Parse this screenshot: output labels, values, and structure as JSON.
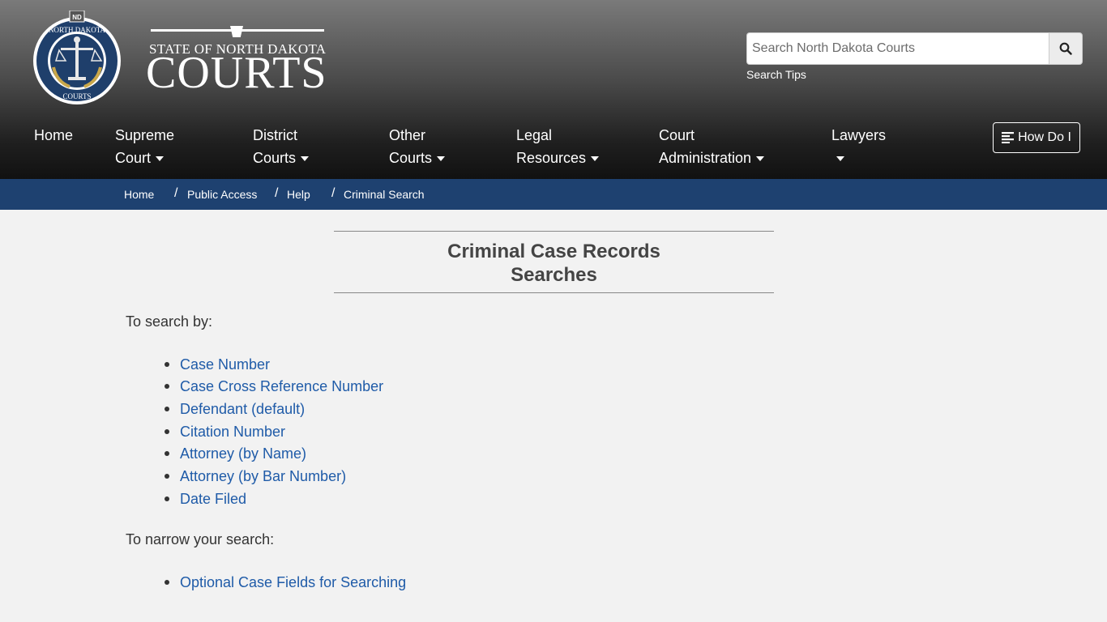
{
  "header": {
    "seal": {
      "top_text": "NORTH DAKOTA",
      "bottom_text": "COURTS",
      "badge": "ND"
    },
    "brand": {
      "line1": "STATE OF NORTH DAKOTA",
      "line2": "COURTS"
    },
    "search": {
      "placeholder": "Search North Dakota Courts",
      "value": "",
      "tips_label": "Search Tips"
    }
  },
  "nav": {
    "items": [
      {
        "line1": "Home",
        "line2": ""
      },
      {
        "line1": "Supreme",
        "line2": "Court"
      },
      {
        "line1": "District",
        "line2": "Courts"
      },
      {
        "line1": "Other",
        "line2": "Courts"
      },
      {
        "line1": "Legal",
        "line2": "Resources"
      },
      {
        "line1": "Court",
        "line2": "Administration"
      },
      {
        "line1": "Lawyers",
        "line2": ""
      }
    ],
    "how_do_i": "How Do I"
  },
  "breadcrumb": [
    "Home",
    "Public Access",
    "Help",
    "Criminal Search"
  ],
  "main": {
    "title_line1": "Criminal Case Records",
    "title_line2": "Searches",
    "search_by_label": "To search by:",
    "search_by_links": [
      "Case Number",
      "Case Cross Reference Number",
      "Defendant (default)",
      "Citation Number",
      "Attorney (by Name)",
      "Attorney (by Bar Number)",
      "Date Filed"
    ],
    "narrow_label": "To narrow your search:",
    "narrow_links": [
      "Optional Case Fields for Searching"
    ]
  },
  "colors": {
    "breadcrumb_bar": "#1e4170",
    "link": "#1f5ba8",
    "seal_blue": "#1f3f6b",
    "seal_gold": "#c9a74a"
  }
}
